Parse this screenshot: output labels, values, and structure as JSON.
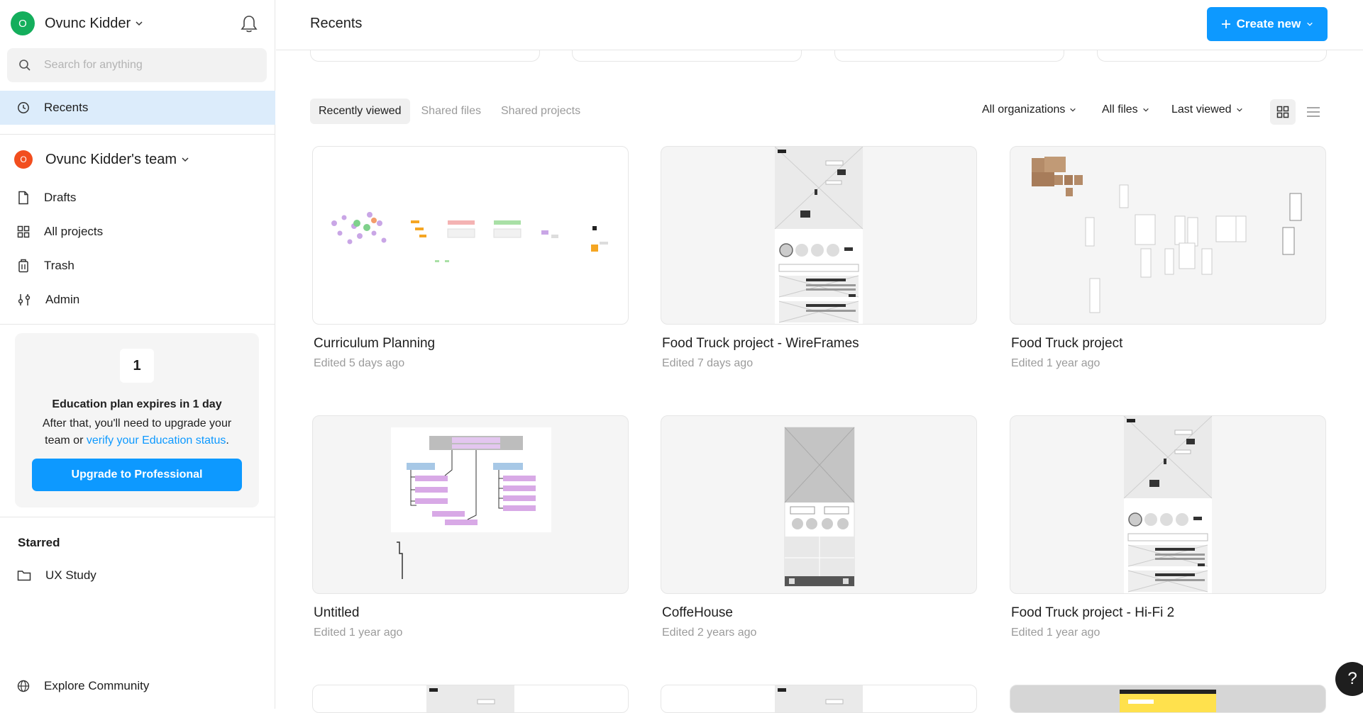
{
  "sidebar": {
    "user": {
      "initial": "O",
      "name": "Ovunc Kidder",
      "color": "#14ae5c"
    },
    "search": {
      "placeholder": "Search for anything"
    },
    "recents_label": "Recents",
    "team": {
      "initial": "O",
      "name": "Ovunc Kidder's team",
      "color": "#f24e1e"
    },
    "items": [
      {
        "label": "Drafts",
        "icon": "file-icon"
      },
      {
        "label": "All projects",
        "icon": "grid-icon"
      },
      {
        "label": "Trash",
        "icon": "trash-icon"
      },
      {
        "label": "Admin",
        "icon": "sliders-icon"
      }
    ],
    "education": {
      "days_left": "1",
      "title": "Education plan expires in 1 day",
      "desc_prefix": "After that, you'll need to upgrade your team or ",
      "link_text": "verify your Education status",
      "desc_suffix": ".",
      "button": "Upgrade to Professional"
    },
    "starred_heading": "Starred",
    "starred": [
      {
        "label": "UX Study",
        "icon": "folder-icon"
      }
    ],
    "explore": "Explore Community"
  },
  "header": {
    "title": "Recents",
    "create_label": "Create new"
  },
  "tabs": [
    "Recently viewed",
    "Shared files",
    "Shared projects"
  ],
  "filters": {
    "organizations": "All organizations",
    "files": "All files",
    "sort": "Last viewed"
  },
  "files": [
    {
      "title": "Curriculum Planning",
      "meta": "Edited 5 days ago"
    },
    {
      "title": "Food Truck project - WireFrames",
      "meta": "Edited 7 days ago"
    },
    {
      "title": "Food Truck project",
      "meta": "Edited 1 year ago"
    },
    {
      "title": "Untitled",
      "meta": "Edited 1 year ago"
    },
    {
      "title": "CoffeHouse",
      "meta": "Edited 2 years ago"
    },
    {
      "title": "Food Truck project - Hi-Fi 2",
      "meta": "Edited 1 year ago"
    }
  ],
  "help_label": "?",
  "colors": {
    "accent": "#0d99ff",
    "active_nav": "#dcecfb",
    "user_avatar": "#14ae5c",
    "team_avatar": "#f24e1e"
  }
}
